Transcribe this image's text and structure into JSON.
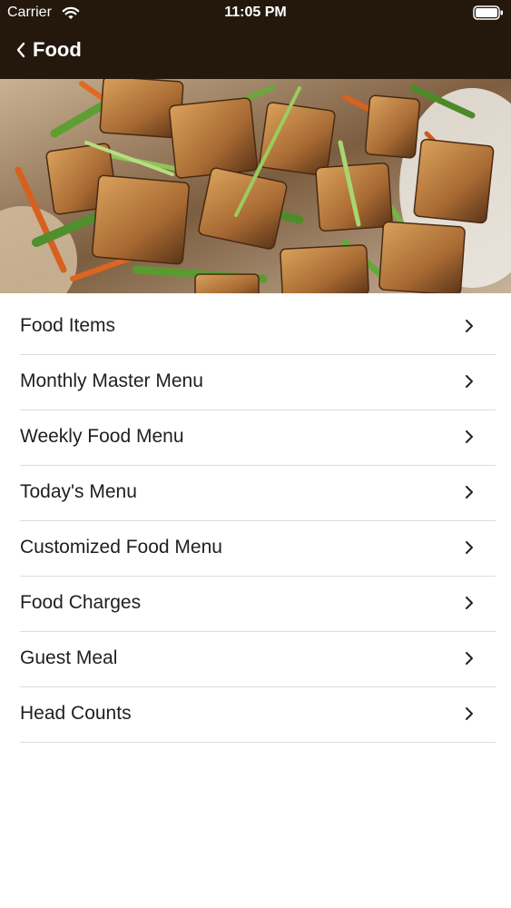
{
  "status_bar": {
    "carrier": "Carrier",
    "time": "11:05 PM",
    "wifi_icon": "wifi-icon",
    "battery_icon": "battery-icon"
  },
  "nav": {
    "back_icon": "chevron-left-icon",
    "title": "Food"
  },
  "banner": {
    "image": "tofu-stir-fry-photo"
  },
  "menu": {
    "chevron_icon": "chevron-right-icon",
    "items": [
      {
        "label": "Food Items"
      },
      {
        "label": "Monthly Master Menu"
      },
      {
        "label": "Weekly Food Menu"
      },
      {
        "label": "Today's Menu"
      },
      {
        "label": "Customized Food Menu"
      },
      {
        "label": "Food Charges"
      },
      {
        "label": "Guest Meal"
      },
      {
        "label": "Head Counts"
      }
    ]
  },
  "colors": {
    "header_background": "#24180d",
    "header_text": "#ffffff",
    "item_text": "#1f1f1f",
    "separator": "#dcdcdc"
  }
}
